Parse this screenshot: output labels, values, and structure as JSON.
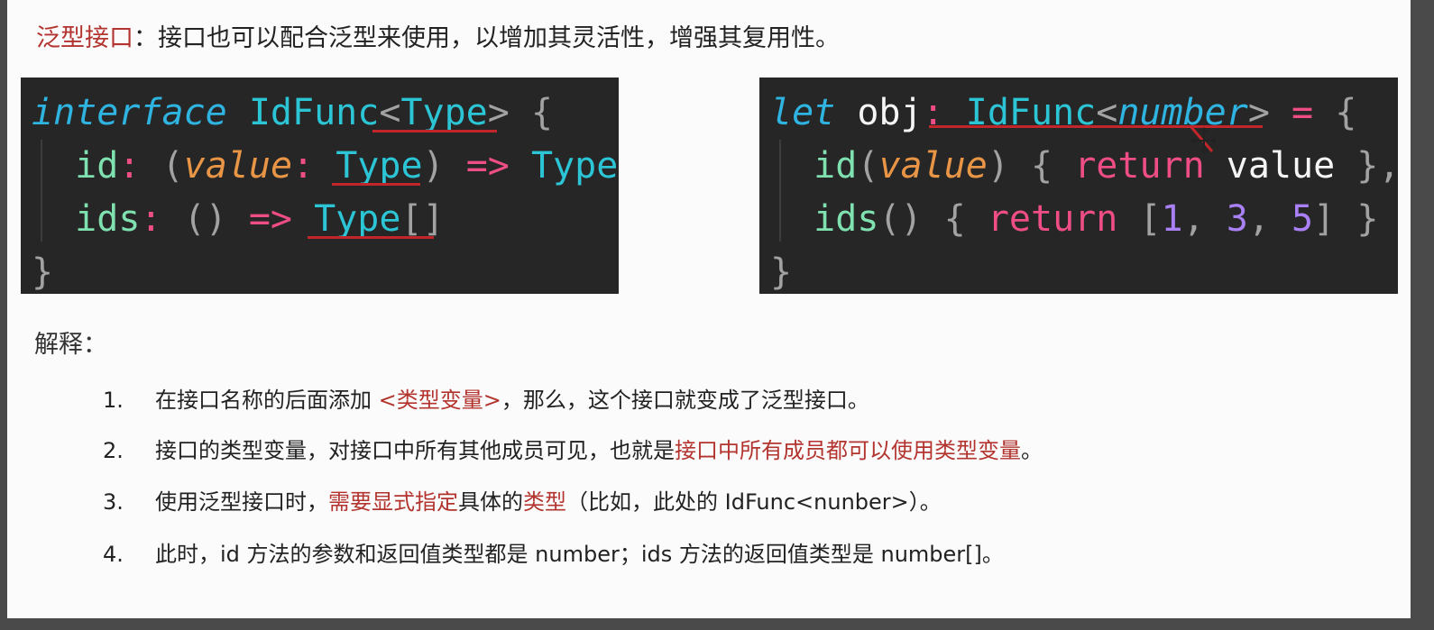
{
  "heading": {
    "term": "泛型接口",
    "text": "：接口也可以配合泛型来使用，以增加其灵活性，增强其复用性。"
  },
  "code_left": {
    "l1": {
      "kw": "interface",
      "name": " IdFunc",
      "lt": "<",
      "type": "Type",
      "gt": ">",
      "brace": " {"
    },
    "l2": {
      "prop": "id",
      "colon": ": ",
      "lp": "(",
      "param": "value",
      "colon2": ": ",
      "type": "Type",
      "rp": ")",
      "arrow": " => ",
      "ret": "Type"
    },
    "l3": {
      "prop": "ids",
      "colon": ": ",
      "parens": "()",
      "arrow": " => ",
      "type": "Type",
      "arr": "[]"
    },
    "l4": "}"
  },
  "code_right": {
    "l1": {
      "kw": "let",
      "name": " obj",
      "colon": ": ",
      "type": "IdFunc",
      "lt": "<",
      "arg": "number",
      "gt": ">",
      "eq": " = ",
      "brace": "{"
    },
    "l2": {
      "prop": "id",
      "lp": "(",
      "param": "value",
      "rp": ")",
      "ob": " { ",
      "ret": "return",
      "val": " value",
      "cb": " },"
    },
    "l3": {
      "prop": "ids",
      "parens": "()",
      "ob": " { ",
      "ret": "return",
      "lb": " [",
      "n1": "1",
      "c1": ", ",
      "n2": "3",
      "c2": ", ",
      "n3": "5",
      "rb": "]",
      "cb": " }"
    },
    "l4": "}"
  },
  "explain": {
    "title": "解释：",
    "items": [
      {
        "num": "1.",
        "a": "在接口名称的后面添加 ",
        "h1": "<类型变量>",
        "b": "，那么，这个接口就变成了泛型接口。"
      },
      {
        "num": "2.",
        "a": "接口的类型变量，对接口中所有其他成员可见，也就是",
        "h1": "接口中所有成员都可以使用类型变量",
        "b": "。"
      },
      {
        "num": "3.",
        "a": "使用泛型接口时，",
        "h1": "需要显式指定",
        "b": "具体的",
        "h2": "类型",
        "c": "（比如，此处的 IdFunc<nunber>）。"
      },
      {
        "num": "4.",
        "a": "此时，id 方法的参数和返回值类型都是 number；ids 方法的返回值类型是 number[]。"
      }
    ]
  },
  "colors": {
    "highlight": "#b3342f",
    "code_bg": "#262626",
    "underline": "#c2262a"
  },
  "icons": {
    "cursor": "move-cursor-icon"
  }
}
